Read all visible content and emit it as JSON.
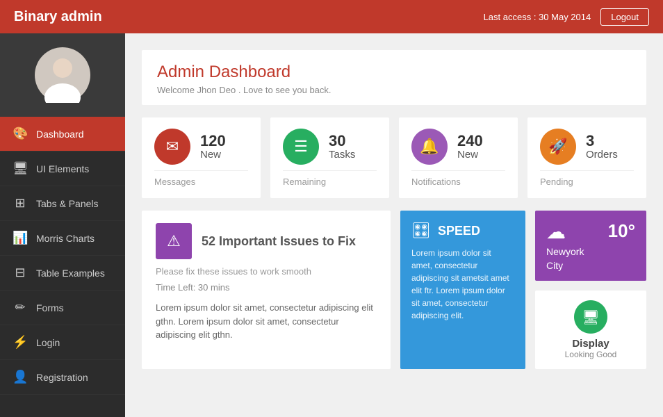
{
  "header": {
    "brand": "Binary admin",
    "last_access": "Last access : 30 May 2014",
    "logout_label": "Logout"
  },
  "sidebar": {
    "items": [
      {
        "label": "Dashboard",
        "icon": "🎨",
        "active": true
      },
      {
        "label": "UI Elements",
        "icon": "🖥",
        "active": false
      },
      {
        "label": "Tabs & Panels",
        "icon": "⊞",
        "active": false
      },
      {
        "label": "Morris Charts",
        "icon": "📊",
        "active": false
      },
      {
        "label": "Table Examples",
        "icon": "⊟",
        "active": false
      },
      {
        "label": "Forms",
        "icon": "✏",
        "active": false
      },
      {
        "label": "Login",
        "icon": "⚡",
        "active": false
      },
      {
        "label": "Registration",
        "icon": "👤",
        "active": false
      }
    ]
  },
  "main": {
    "page_title": "Admin Dashboard",
    "page_subtitle": "Welcome Jhon Deo . Love to see you back.",
    "stats": [
      {
        "num": "120",
        "label_top": "New",
        "label_bottom": "Messages",
        "icon_color": "red",
        "icon": "✉"
      },
      {
        "num": "30",
        "label_top": "Tasks",
        "label_bottom": "Remaining",
        "icon_color": "green",
        "icon": "☰"
      },
      {
        "num": "240",
        "label_top": "New",
        "label_bottom": "Notifications",
        "icon_color": "purple",
        "icon": "🔔"
      },
      {
        "num": "3",
        "label_top": "Orders",
        "label_bottom": "Pending",
        "icon_color": "orange",
        "icon": "🚀"
      }
    ],
    "alert": {
      "title": "52 Important Issues to Fix",
      "subtitle": "Please fix these issues to work smooth",
      "time_left": "Time Left: 30 mins",
      "body": "Lorem ipsum dolor sit amet, consectetur adipiscing elit gthn. Lorem ipsum dolor sit amet, consectetur adipiscing elit gthn.",
      "icon": "⚠"
    },
    "speed": {
      "title": "SPEED",
      "icon": "🎛",
      "body": "Lorem ipsum dolor sit amet, consectetur adipiscing sit ametsit amet elit ftr. Lorem ipsum dolor sit amet, consectetur adipiscing elit."
    },
    "weather": {
      "temp": "10°",
      "city1": "Newyork",
      "city2": "City",
      "icon": "☁"
    },
    "display": {
      "label": "Display",
      "sub": "Looking Good",
      "icon": "🖥"
    }
  }
}
